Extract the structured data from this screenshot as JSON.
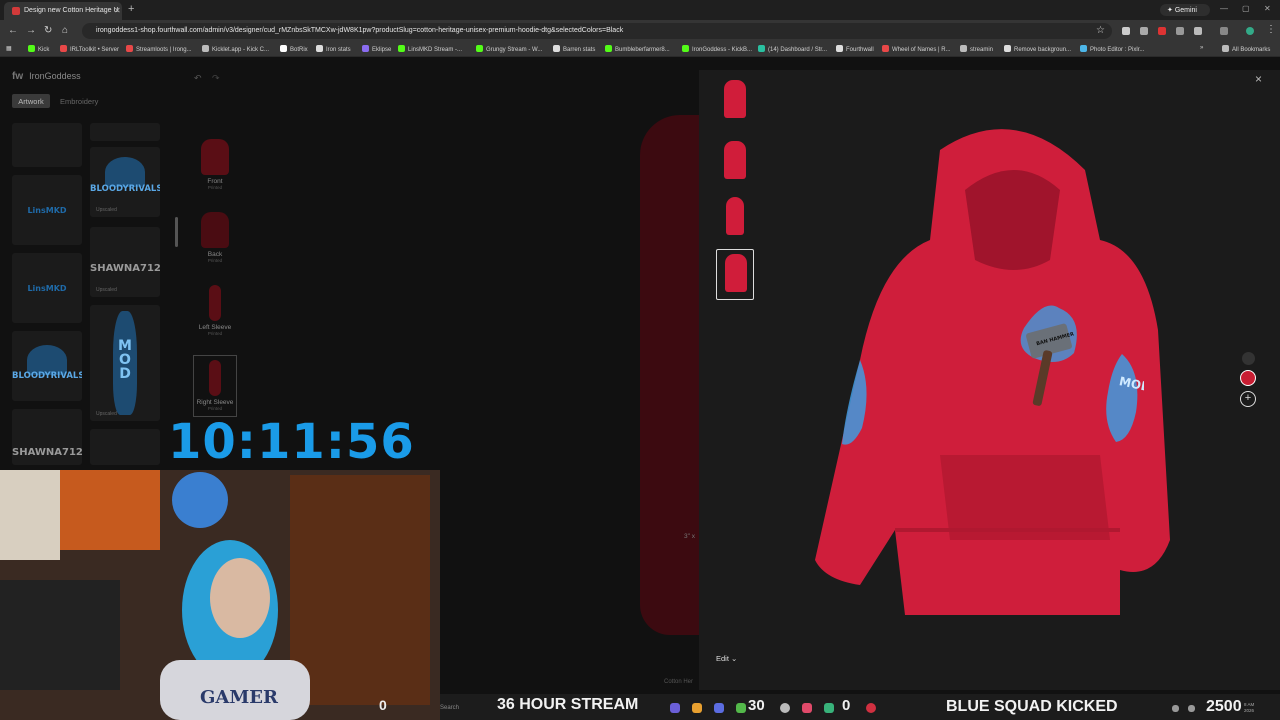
{
  "browser": {
    "tab_title": "Design new Cotton Heritage U",
    "url": "irongoddess1-shop.fourthwall.com/admin/v3/designer/cud_rMZnbsSkTMCXw-jdW8K1pw?productSlug=cotton-heritage-unisex-premium-hoodie-dtg&selectedColors=Black",
    "gemini_label": "Gemini",
    "all_bookmarks": "All Bookmarks",
    "bookmarks": [
      "Kick",
      "IRLToolkit • Server",
      "Streamloots | Irong...",
      "Kicklet.app - Kick C...",
      "BotRix",
      "Iron stats",
      "Eklipse",
      "LinsMKD Stream -...",
      "Grungy Stream - W...",
      "Barren stats",
      "Bumbleberfarmer8...",
      "IronGoddess - KickB...",
      "(14) Dashboard / Str...",
      "Fourthwall",
      "Wheel of Names | R...",
      "streamin",
      "Remove backgroun...",
      "Photo Editor : Pixlr..."
    ],
    "bookmark_colors": [
      "#53fc18",
      "#e84848",
      "#e84848",
      "#bbbbbb",
      "#ffffff",
      "#dddddd",
      "#8a6cf0",
      "#53fc18",
      "#53fc18",
      "#dddddd",
      "#53fc18",
      "#53fc18",
      "#2ac0a0",
      "#dddddd",
      "#e84848",
      "#bbbbbb",
      "#dddddd",
      "#4db6e8"
    ]
  },
  "designer": {
    "brand": "IronGoddess",
    "brand_mark": "fw",
    "tabs": {
      "artwork": "Artwork",
      "embroidery": "Embroidery"
    },
    "artwork": [
      {
        "text": "LinsMKD",
        "sub": ""
      },
      {
        "text": "BLOODYRIVALS",
        "sub": "Upscaled"
      },
      {
        "text": "LinsMKD",
        "sub": ""
      },
      {
        "text": "SHAWNA712",
        "sub": "Upscaled"
      },
      {
        "text": "BLOODYRIVALS",
        "sub": ""
      },
      {
        "text": "MOD",
        "sub": "Upscaled"
      },
      {
        "text": "SHAWNA712",
        "sub": ""
      }
    ],
    "sides": [
      {
        "label": "Front",
        "sub": "Printed"
      },
      {
        "label": "Back",
        "sub": "Printed"
      },
      {
        "label": "Left Sleeve",
        "sub": "Printed"
      },
      {
        "label": "Right Sleeve",
        "sub": "Printed"
      }
    ],
    "canvas_dim": "3\" x",
    "canvas_caption": "Cotton Her"
  },
  "preview": {
    "close_icon": "×",
    "edit_label": "Edit",
    "hammer_text": "BAN HAMMER",
    "sleeve_text": "MOD",
    "selected_color": "#c81e33"
  },
  "overlay": {
    "timer": "10:11:56",
    "cam_count": "0",
    "search_label": "Search",
    "ticker_left": "36 HOUR STREAM",
    "count_30": "30",
    "count_0": "0",
    "ticker_right": "BLUE SQUAD KICKED",
    "points": "2500",
    "clock_line1": "8 AM",
    "clock_line2": "2026",
    "shirt_text": "GAMER"
  }
}
